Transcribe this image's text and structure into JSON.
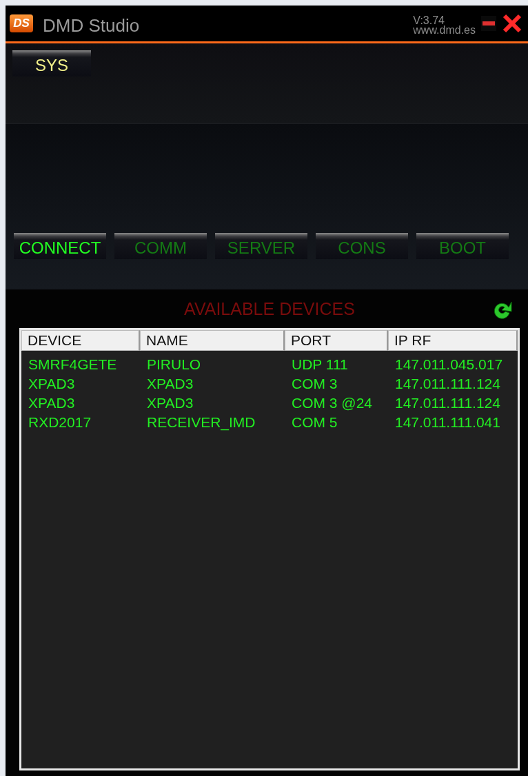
{
  "window": {
    "title": "DMD Studio",
    "logo": "DS",
    "version": "V:3.74",
    "website": "www.dmd.es"
  },
  "top_button": "SYS",
  "tabs": [
    {
      "label": "CONNECT",
      "selected": true
    },
    {
      "label": "COMM",
      "selected": false
    },
    {
      "label": "SERVER",
      "selected": false
    },
    {
      "label": "CONS",
      "selected": false
    },
    {
      "label": "BOOT",
      "selected": false
    }
  ],
  "section_title": "AVAILABLE DEVICES",
  "table": {
    "columns": [
      "DEVICE",
      "NAME",
      "PORT",
      "IP RF"
    ],
    "rows": [
      [
        "SMRF4GETE",
        "PIRULO",
        "UDP 111",
        "147.011.045.017"
      ],
      [
        "XPAD3",
        "XPAD3",
        "COM 3",
        "147.011.111.124"
      ],
      [
        "XPAD3",
        "XPAD3",
        "COM 3 @24",
        "147.011.111.124"
      ],
      [
        "RXD2017",
        "RECEIVER_IMD",
        "COM 5",
        "147.011.111.041"
      ]
    ]
  }
}
